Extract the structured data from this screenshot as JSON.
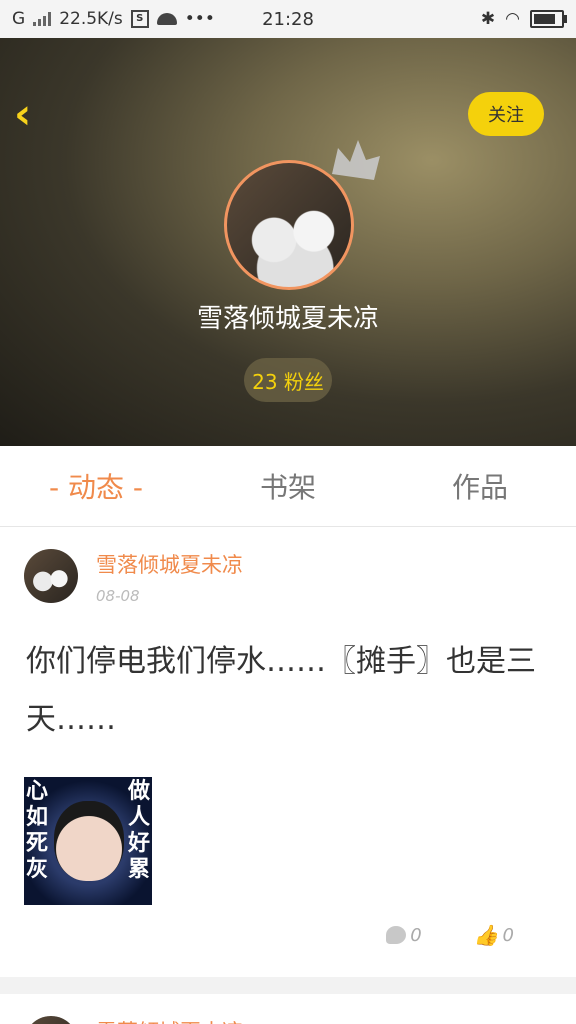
{
  "status_bar": {
    "carrier": "G",
    "speed": "22.5K/s",
    "time": "21:28",
    "icons": [
      "signal-icon",
      "s-app-icon",
      "android-icon",
      "more-icon",
      "bluetooth-icon",
      "wifi-icon",
      "battery-icon"
    ]
  },
  "header": {
    "back_icon": "chevron-left-icon",
    "follow_label": "关注",
    "username": "雪落倾城夏未凉",
    "fans_label": "23 粉丝"
  },
  "tabs": [
    {
      "label": "- 动态 -",
      "active": true
    },
    {
      "label": "书架",
      "active": false
    },
    {
      "label": "作品",
      "active": false
    }
  ],
  "post": {
    "author": "雪落倾城夏未凉",
    "date": "08-08",
    "text": "你们停电我们停水……〖摊手〗也是三天……",
    "image_caption_left": "心如死灰",
    "image_caption_right": "做人好累",
    "comments": "0",
    "likes": "0"
  },
  "next_post": {
    "author": "雪落倾城夏未凉"
  },
  "colors": {
    "accent": "#f08a4b",
    "follow_bg": "#f4d10c",
    "back_arrow": "#f7d21b"
  }
}
